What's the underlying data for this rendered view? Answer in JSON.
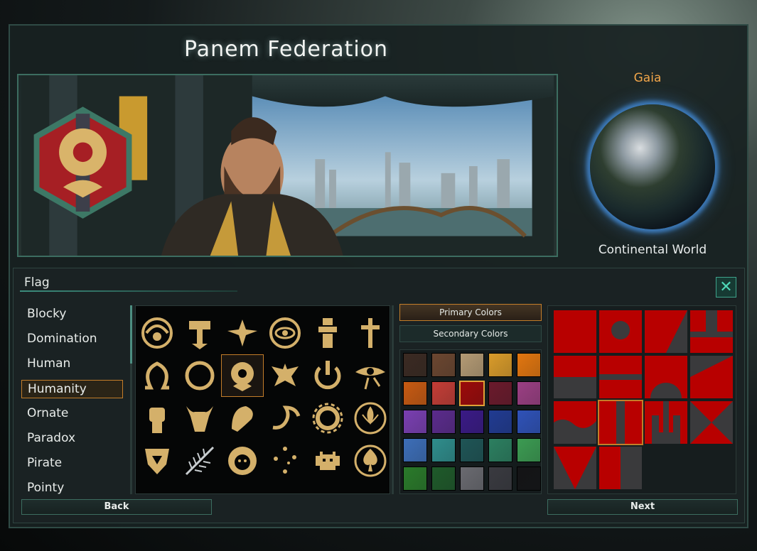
{
  "empire": {
    "name": "Panem Federation"
  },
  "homeworld": {
    "name": "Gaia",
    "type": "Continental World"
  },
  "flag_panel": {
    "title": "Flag",
    "close_icon": "close-x-icon",
    "categories": [
      "Blocky",
      "Domination",
      "Human",
      "Humanity",
      "Ornate",
      "Paradox",
      "Pirate",
      "Pointy"
    ],
    "selected_category": "Humanity",
    "emblems": [
      "spiral-shell",
      "mjolnir",
      "winged-bird",
      "eye-circle",
      "totem",
      "cross",
      "omega",
      "ouroboros-ring",
      "mockingjay-sunburst",
      "eagle",
      "power-ring",
      "eye-of-horus",
      "raised-fist",
      "bull-head",
      "lion-sea",
      "scorpion",
      "gear",
      "fleur-de-lis",
      "shield-eagle",
      "fern-leaf",
      "lion-face",
      "southern-cross",
      "space-invader",
      "spade"
    ],
    "selected_emblem": "mockingjay-sunburst",
    "primary_tab": "Primary Colors",
    "secondary_tab": "Secondary Colors",
    "active_color_tab": "Primary Colors",
    "colors": [
      "#3b2a22",
      "#6b4630",
      "#b49a74",
      "#d99b2a",
      "#e2760f",
      "#c75a12",
      "#c33d36",
      "#9b0a0a",
      "#6b1a2c",
      "#9b3f83",
      "#7a3fb1",
      "#5b2b8c",
      "#3a1a86",
      "#213b92",
      "#2f52b8",
      "#3d6eb8",
      "#2f8d8c",
      "#1f5556",
      "#2c7f60",
      "#3c9b52",
      "#2a7a2a",
      "#1f5a2a",
      "#6a6a70",
      "#3a3a40",
      "#141416"
    ],
    "selected_color_index": 7,
    "patterns": [
      "split-vertical",
      "circle-top",
      "diagonal-triangles",
      "notched-top",
      "half-horizontal",
      "bar-horizontal",
      "half-circle",
      "diagonal-corner",
      "wave-bottom",
      "center-stripe",
      "trident",
      "bowtie",
      "triangle-down",
      "split-half-right"
    ],
    "selected_pattern_index": 9,
    "pattern_primary_color": "#b80000",
    "pattern_secondary_color": "#3a3a3c"
  },
  "navigation": {
    "back_label": "Back",
    "next_label": "Next"
  },
  "accent_color": "#c37d29"
}
